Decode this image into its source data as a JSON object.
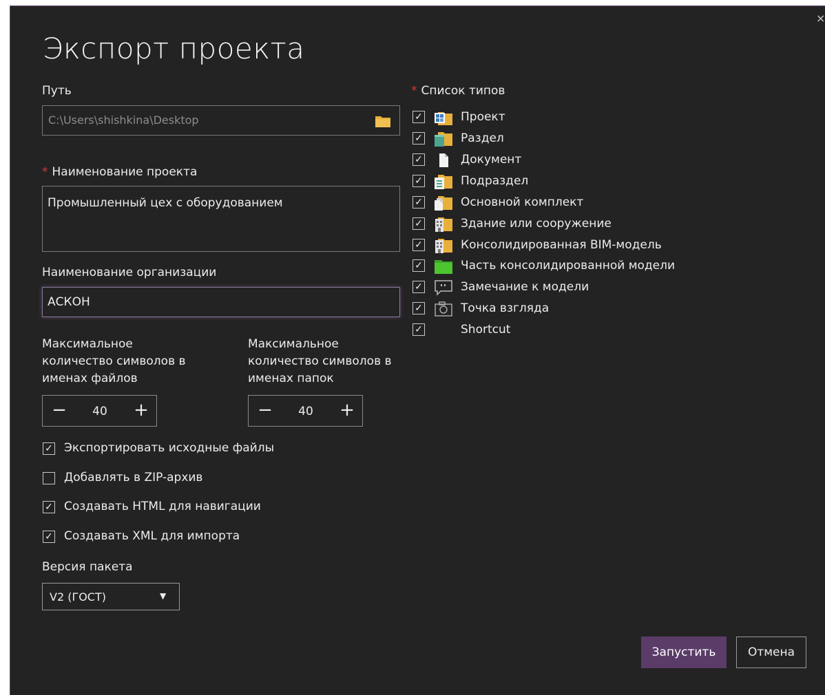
{
  "dialog": {
    "title": "Экспорт проекта",
    "close_label": "×"
  },
  "path": {
    "label": "Путь",
    "value": "C:\\Users\\shishkina\\Desktop"
  },
  "project_name": {
    "required_mark": "*",
    "label": "Наименование проекта",
    "value": "Промышленный цех с оборудованием"
  },
  "org_name": {
    "label": "Наименование организации",
    "value": "АСКОН"
  },
  "max_file_chars": {
    "label_lines": [
      "Максимальное",
      "количество символов в",
      "именах файлов"
    ],
    "value": "40",
    "minus": "−",
    "plus": "+"
  },
  "max_folder_chars": {
    "label_lines": [
      "Максимальное",
      "количество символов в",
      "именах папок"
    ],
    "value": "40",
    "minus": "−",
    "plus": "+"
  },
  "options": [
    {
      "label": "Экспортировать исходные файлы",
      "checked": true
    },
    {
      "label": "Добавлять в ZIP-архив",
      "checked": false
    },
    {
      "label": "Создавать HTML для навигации",
      "checked": true
    },
    {
      "label": "Создавать XML для импорта",
      "checked": true
    }
  ],
  "version": {
    "label": "Версия пакета",
    "value": "V2 (ГОСТ)",
    "arrow": "▼"
  },
  "types": {
    "required_mark": "*",
    "label": "Список типов",
    "items": [
      {
        "label": "Проект",
        "icon": "project-folder-icon",
        "checked": true
      },
      {
        "label": "Раздел",
        "icon": "section-folder-icon",
        "checked": true
      },
      {
        "label": "Документ",
        "icon": "document-icon",
        "checked": true
      },
      {
        "label": "Подраздел",
        "icon": "subsection-folder-icon",
        "checked": true
      },
      {
        "label": "Основной комплект",
        "icon": "main-set-folder-icon",
        "checked": true
      },
      {
        "label": "Здание или сооружение",
        "icon": "building-folder-icon",
        "checked": true
      },
      {
        "label": "Консолидированная BIM-модель",
        "icon": "bim-model-folder-icon",
        "checked": true
      },
      {
        "label": "Часть консолидированной модели",
        "icon": "green-folder-icon",
        "checked": true
      },
      {
        "label": "Замечание к модели",
        "icon": "comment-icon",
        "checked": true
      },
      {
        "label": "Точка взгляда",
        "icon": "camera-icon",
        "checked": true
      },
      {
        "label": "Shortcut",
        "icon": "",
        "checked": true
      }
    ]
  },
  "buttons": {
    "run": "Запустить",
    "cancel": "Отмена"
  },
  "colors": {
    "background": "#232323",
    "accent": "#5b3c68",
    "required": "#d23a3a",
    "folder": "#e8b03a",
    "green_folder": "#4cc531"
  },
  "check_glyph": "✓"
}
